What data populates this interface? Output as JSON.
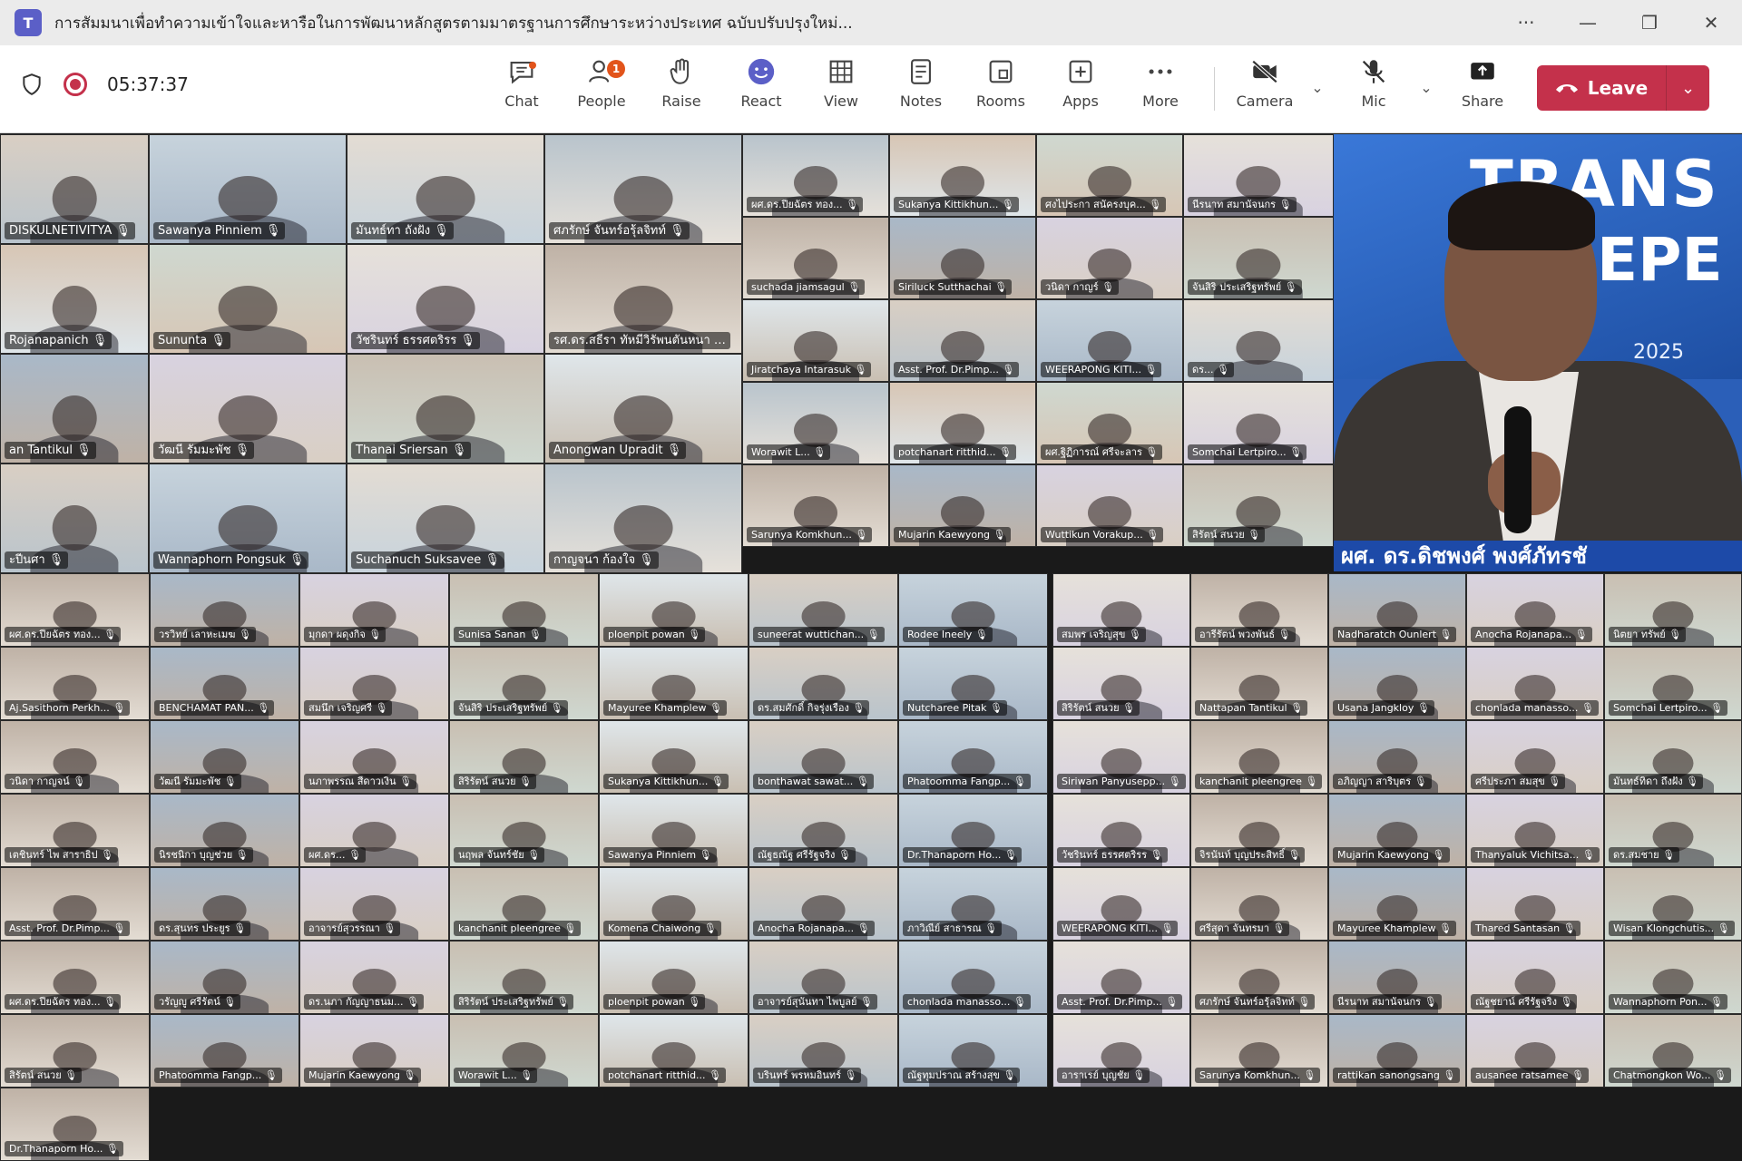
{
  "window": {
    "title": "การสัมมนาเพื่อทำความเข้าใจและหารือในการพัฒนาหลักสูตรตามมาตรฐานการศึกษาระหว่างประเทศ ฉบับปรับปรุงใหม่...",
    "app_icon": "teams-logo",
    "controls": [
      "more-icon",
      "minimize-icon",
      "restore-icon",
      "close-icon"
    ]
  },
  "toolbar": {
    "timer": "05:37:37",
    "buttons": {
      "chat": "Chat",
      "people": "People",
      "people_badge": "1",
      "raise": "Raise",
      "react": "React",
      "view": "View",
      "notes": "Notes",
      "rooms": "Rooms",
      "apps": "Apps",
      "more": "More",
      "camera": "Camera",
      "mic": "Mic",
      "share": "Share"
    },
    "leave_label": "Leave",
    "leave_color": "#c4314b",
    "accent_color": "#5b5fc7"
  },
  "speaker": {
    "banner_line1": "TRANS",
    "banner_line2": "EPE",
    "banner_line3": "2025",
    "caption": "ผศ. ดร.ดิชพงศ์ พงศ์ภัทรชั"
  },
  "gallery_large": [
    "DISKULNETIVITYA",
    "Sawanya Pinniem",
    "มันทธ์ทา ถังฝัง",
    "ศภรักษ์ จันทร์อรุ้ลจิทท์",
    "Rojanapanich",
    "Sununta",
    "วัชรินทร์ ธรรศตริรร",
    "รศ.ดร.สธีรา ทัหมีวิรัพนตันหนา",
    "an Tantikul",
    "วัฒนี รัมมะพัช",
    "Thanai Sriersan",
    "Anongwan Upradit",
    "ะปีนศา",
    "Wannaphorn Pongsuk",
    "Suchanuch Suksavee",
    "กาญจนา ก้องใจ"
  ],
  "gallery_mid": [
    "ผศ.ดร.ปียฉัตร ทอง...",
    "Sukanya Kittikhun...",
    "ศงไประกา สนัครงบุค...",
    "นีรนาท สมานัจนกร",
    "suchada jiamsagul",
    "Siriluck Sutthachai",
    "วนิดา กาญร์",
    "จันสิริ ประเสริฐทรัพย์",
    "Jiratchaya Intarasuk",
    "Asst. Prof. Dr.Pimp...",
    "WEERAPONG KITI...",
    "ดร...",
    "Worawit L...",
    "potchanart ritthid...",
    "ผศ.ฐิฏิการณ์ ศรีจะลาร",
    "Somchai Lertpiro...",
    "Sarunya Komkhun...",
    "Mujarin Kaewyong",
    "Wuttikun Vorakup...",
    "สิรัตน์ สนวย"
  ],
  "gallery_small": [
    "ผศ.ดร.ปียฉัตร ทอง...",
    "วรวิทย์ เลาหะเมฆ",
    "มุกดา ผดุงกิจ",
    "Sunisa Sanan",
    "ploenpit powan",
    "suneerat wuttichan...",
    "Rodee Ineely",
    "สมพร เจริญสุข",
    "อารีรัตน์ พวงพันธ์",
    "Nadharatch Ounlert",
    "Anocha Rojanapa...",
    "นิตยา ทรัพย์",
    "Aj.Sasithorn Perkh...",
    "BENCHAMAT PAN...",
    "สมนึก เจริญศรี",
    "จันสิริ ประเสริฐทรัพย์",
    "Mayuree Khamplew",
    "ดร.สมศักดิ์ กิจรุ่งเรือง",
    "Nutcharee Pitak",
    "สิริรัตน์ สนวย",
    "Nattapan Tantikul",
    "Usana Jangkloy",
    "chonlada manasso...",
    "Somchai Lertpiro...",
    "วนิดา กาญจน์",
    "วัฒนี รัมมะพัช",
    "นภาพรรณ สีดาวเงิน",
    "สิริรัตน์ สนวย",
    "Sukanya Kittikhun...",
    "bonthawat sawat...",
    "Phatoomma Fangp...",
    "Siriwan Panyusepp...",
    "kanchanit pleengree",
    "อภิญญา สาริบุตร",
    "ศรีประภา สมสุข",
    "มันทธ์ทิดา ถึงฝัง",
    "เตชินทร์ ไพ สาราธิป",
    "นิรชนิกา บุญช่วย",
    "ผศ.ดร...",
    "นฤพล จันทร์ชัย",
    "Sawanya Pinniem",
    "ณัฐธณัฐ ศรีรัฐจริง",
    "Dr.Thanaporn Ho...",
    "วัชรินทร์ ธรรศตริรร",
    "จิรนันท์ บุญประสิทธิ์",
    "Mujarin Kaewyong",
    "Thanyaluk Vichitsa...",
    "ดร.สมชาย",
    "Asst. Prof. Dr.Pimp...",
    "ดร.สุนทร ประยูร",
    "อาจารย์สุวรรณา",
    "kanchanit pleengree",
    "Komena Chaiwong",
    "Anocha Rojanapa...",
    "ภาวิณีย์ สาธารณ",
    "WEERAPONG KITI...",
    "ศรีสุดา จันทรมา",
    "Mayuree Khamplew",
    "Thared Santasan",
    "Wisan Klongchutis...",
    "ผศ.ดร.ปียฉัตร ทอง...",
    "วรัญญู ศรีรัตน์",
    "ดร.นภา กัญญาธนม...",
    "สิริรัตน์ ประเสริฐทรัพย์",
    "ploenpit powan",
    "อาจารย์สุนันทา ไพบูลย์",
    "chonlada manasso...",
    "Asst. Prof. Dr.Pimp...",
    "ศภรักษ์ จันทร์อรุ้ลจิทท์",
    "นีรนาท สมานัจนกร",
    "ณัฐชยาน์ ศรีรัฐจริง",
    "Wannaphorn Pon...",
    "สิรัตน์ สนวย",
    "Phatoomma Fangp...",
    "Mujarin Kaewyong",
    "Worawit L...",
    "potchanart ritthid...",
    "บรินทร์ พรหมอินทร์",
    "ณัฐทุมปราณ สร้างสุข",
    "อาราเรย์ บุญชัย",
    "Sarunya Komkhun...",
    "rattikan sanongsang",
    "ausanee ratsamee",
    "Chatmongkon Wo...",
    "Dr.Thanaporn Ho..."
  ]
}
